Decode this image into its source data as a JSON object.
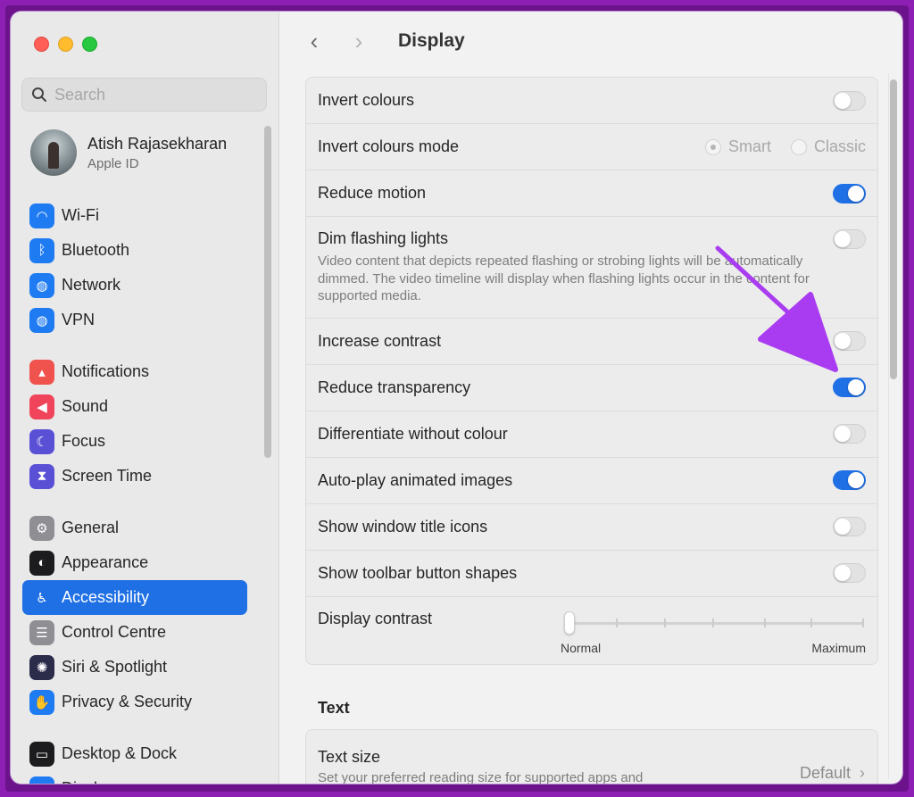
{
  "search": {
    "placeholder": "Search"
  },
  "profile": {
    "name": "Atish Rajasekharan",
    "subtitle": "Apple ID"
  },
  "sidebar": {
    "items": [
      {
        "label": "Wi-Fi",
        "icon": "wifi-icon",
        "color": "#1f7bf2",
        "glyph": "◠"
      },
      {
        "label": "Bluetooth",
        "icon": "bluetooth-icon",
        "color": "#1f7bf2",
        "glyph": "ᛒ"
      },
      {
        "label": "Network",
        "icon": "globe-icon",
        "color": "#1f7bf2",
        "glyph": "◍"
      },
      {
        "label": "VPN",
        "icon": "vpn-globe-icon",
        "color": "#1f7bf2",
        "glyph": "◍"
      },
      {
        "label": "Notifications",
        "icon": "bell-icon",
        "color": "#f0534e",
        "glyph": "▴"
      },
      {
        "label": "Sound",
        "icon": "speaker-icon",
        "color": "#f0445a",
        "glyph": "◀"
      },
      {
        "label": "Focus",
        "icon": "moon-icon",
        "color": "#5a50d6",
        "glyph": "☾"
      },
      {
        "label": "Screen Time",
        "icon": "hourglass-icon",
        "color": "#5a50d6",
        "glyph": "⧗"
      },
      {
        "label": "General",
        "icon": "gear-icon",
        "color": "#8e8e93",
        "glyph": "⚙"
      },
      {
        "label": "Appearance",
        "icon": "appearance-icon",
        "color": "#1c1c1e",
        "glyph": "◐"
      },
      {
        "label": "Accessibility",
        "icon": "accessibility-icon",
        "color": "#1f6fe5",
        "glyph": "♿"
      },
      {
        "label": "Control Centre",
        "icon": "control-centre-icon",
        "color": "#8e8e93",
        "glyph": "☰"
      },
      {
        "label": "Siri & Spotlight",
        "icon": "siri-icon",
        "color": "#2b2b4a",
        "glyph": "✺"
      },
      {
        "label": "Privacy & Security",
        "icon": "hand-icon",
        "color": "#1f7bf2",
        "glyph": "✋"
      },
      {
        "label": "Desktop & Dock",
        "icon": "dock-icon",
        "color": "#1c1c1e",
        "glyph": "▭"
      },
      {
        "label": "Displays",
        "icon": "display-icon",
        "color": "#1f7bf2",
        "glyph": "✹"
      }
    ]
  },
  "toolbar": {
    "back": "‹",
    "forward": "›",
    "title": "Display"
  },
  "settings": {
    "invert_colours": {
      "label": "Invert colours",
      "on": false
    },
    "invert_mode": {
      "label": "Invert colours mode",
      "option_smart": "Smart",
      "option_classic": "Classic",
      "selected": "Smart"
    },
    "reduce_motion": {
      "label": "Reduce motion",
      "on": true
    },
    "dim_flashing": {
      "label": "Dim flashing lights",
      "description": "Video content that depicts repeated flashing or strobing lights will be automatically dimmed. The video timeline will display when flashing lights occur in the content for supported media.",
      "on": false
    },
    "increase_contrast": {
      "label": "Increase contrast",
      "on": false
    },
    "reduce_transparency": {
      "label": "Reduce transparency",
      "on": true
    },
    "differentiate": {
      "label": "Differentiate without colour",
      "on": false
    },
    "autoplay": {
      "label": "Auto-play animated images",
      "on": true
    },
    "window_title_icons": {
      "label": "Show window title icons",
      "on": false
    },
    "toolbar_shapes": {
      "label": "Show toolbar button shapes",
      "on": false
    },
    "display_contrast": {
      "label": "Display contrast",
      "min_label": "Normal",
      "max_label": "Maximum",
      "value": 0
    }
  },
  "text_section": {
    "title": "Text",
    "text_size": {
      "label": "Text size",
      "description": "Set your preferred reading size for supported apps and",
      "value": "Default"
    }
  },
  "colors": {
    "accent": "#1f6fe5",
    "annotation_arrow": "#a93cf0"
  }
}
